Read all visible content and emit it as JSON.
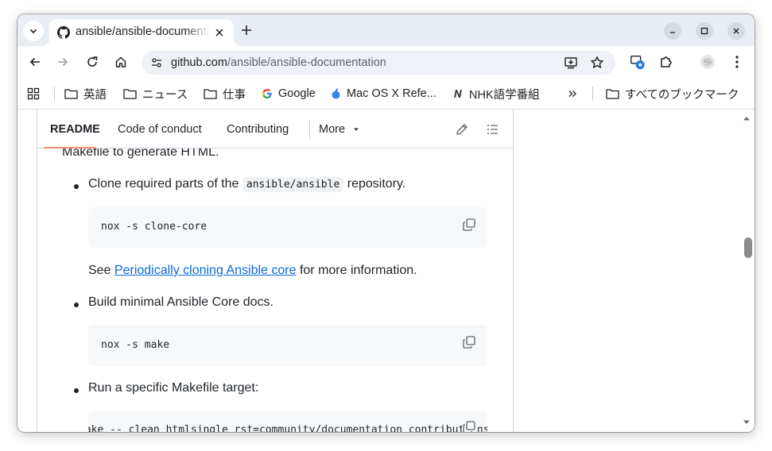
{
  "tab": {
    "title": "ansible/ansible-documentation"
  },
  "toolbar": {
    "url_host": "github.com",
    "url_path": "/ansible/ansible-documentation"
  },
  "bookmarks": [
    {
      "label": "英語",
      "icon": "folder-icon"
    },
    {
      "label": "ニュース",
      "icon": "folder-icon"
    },
    {
      "label": "仕事",
      "icon": "folder-icon"
    },
    {
      "label": "Google",
      "icon": "google-icon"
    },
    {
      "label": "Mac OS X Refe...",
      "icon": "apple-icon"
    },
    {
      "label": "NHK語学番組",
      "icon": "nhk-icon"
    },
    {
      "label": "すべてのブックマーク",
      "icon": "folder-icon"
    }
  ],
  "readme_tabs": {
    "readme": "README",
    "code_of_conduct": "Code of conduct",
    "contributing": "Contributing",
    "more": "More"
  },
  "content": {
    "intro_tail": "Makefile to generate HTML.",
    "item1_before": "Clone required parts of the ",
    "item1_code": "ansible/ansible",
    "item1_after": " repository.",
    "code1": "nox -s clone-core",
    "see_prefix": "See ",
    "see_link": "Periodically cloning Ansible core",
    "see_suffix": " for more information.",
    "item2": "Build minimal Ansible Core docs.",
    "code2": "nox -s make",
    "item3": "Run a specific Makefile target:",
    "code3": "make -- clean htmlsingle rst=community/documentation_contributions.rst"
  },
  "colors": {
    "link": "#0969da",
    "tab_underline": "#fd8c73",
    "code_bg": "#f6f8fa",
    "tabstrip_bg": "#e9edf4"
  }
}
